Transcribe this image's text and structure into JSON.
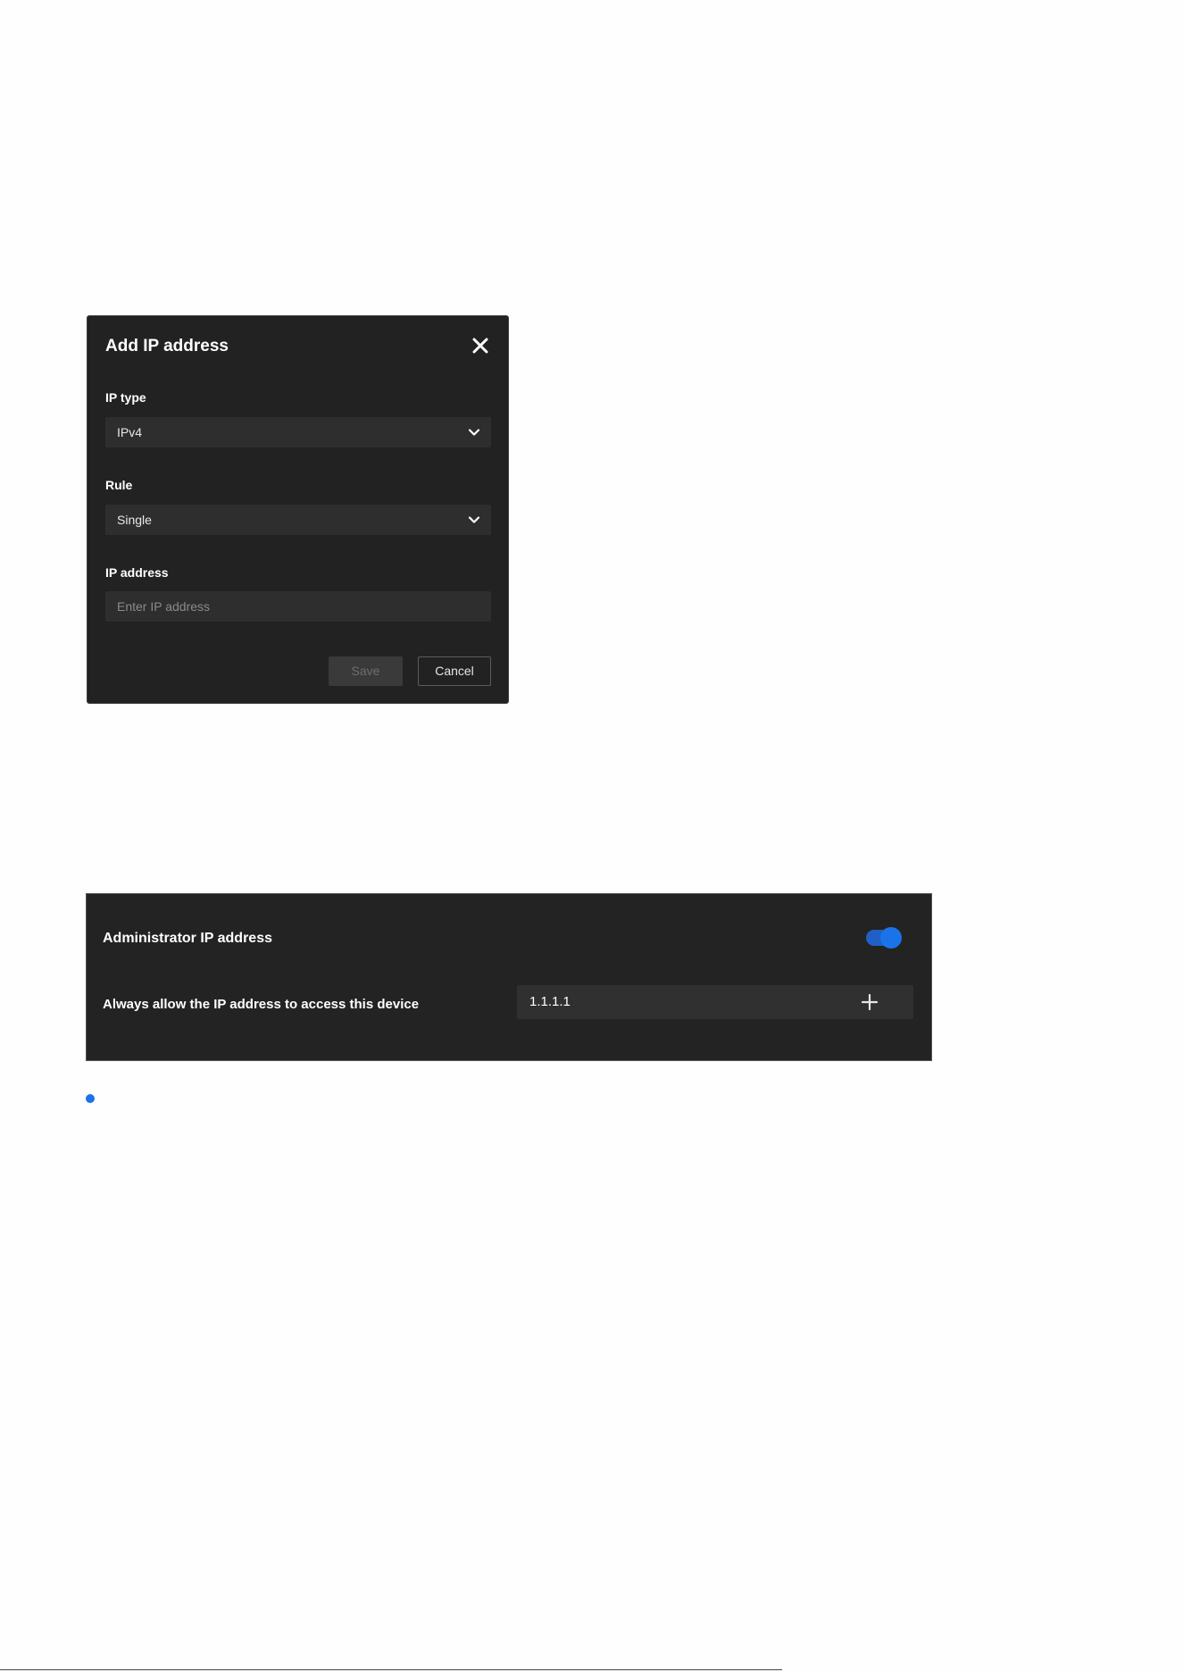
{
  "dialog": {
    "title": "Add IP address",
    "close_icon": "close-icon",
    "ip_type": {
      "label": "IP type",
      "selected": "IPv4",
      "icon": "chevron-down-icon"
    },
    "rule": {
      "label": "Rule",
      "selected": "Single",
      "icon": "chevron-down-icon"
    },
    "ip_address": {
      "label": "IP address",
      "value": "",
      "placeholder": "Enter IP address"
    },
    "save_label": "Save",
    "cancel_label": "Cancel"
  },
  "panel": {
    "title": "Administrator IP address",
    "toggle_on": true,
    "allow_label": "Always allow the IP address to access this device",
    "ip_value": "1.1.1.1",
    "add_icon": "plus-icon"
  },
  "colors": {
    "accent": "#1a73e8",
    "dialog_bg": "#222222",
    "field_bg": "#2e2e2e",
    "page_bg": "#fefefe"
  }
}
